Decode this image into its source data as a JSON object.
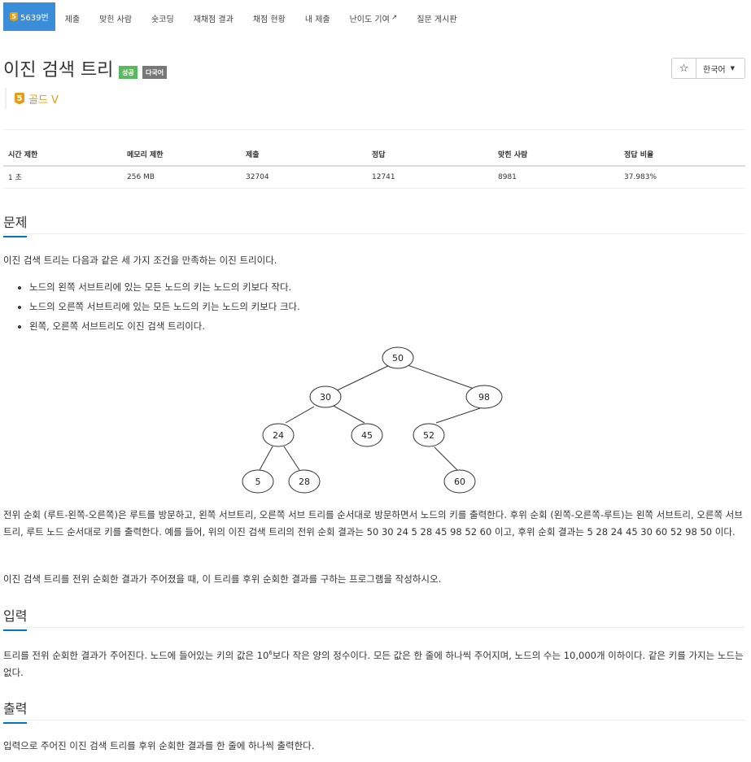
{
  "nav": {
    "problem_id": "5639번",
    "tier_digit": "5",
    "tabs": [
      "제출",
      "맞힌 사람",
      "숏코딩",
      "재채점 결과",
      "채점 현황",
      "내 제출",
      "난이도 기여",
      "질문 게시판"
    ]
  },
  "problem": {
    "title": "이진 검색 트리",
    "labels": {
      "success": "성공",
      "multilang": "다국어"
    },
    "tier": "골드 V",
    "tier_digit": "5",
    "lang": "한국어",
    "star": "☆"
  },
  "info_table": {
    "headers": [
      "시간 제한",
      "메모리 제한",
      "제출",
      "정답",
      "맞힌 사람",
      "정답 비율"
    ],
    "values": [
      "1 초",
      "256 MB",
      "32704",
      "12741",
      "8981",
      "37.983%"
    ]
  },
  "sections": {
    "problem_title": "문제",
    "problem_intro": "이진 검색 트리는 다음과 같은 세 가지 조건을 만족하는 이진 트리이다.",
    "conditions": [
      "노드의 왼쪽 서브트리에 있는 모든 노드의 키는 노드의 키보다 작다.",
      "노드의 오른쪽 서브트리에 있는 모든 노드의 키는 노드의 키보다 크다.",
      "왼쪽, 오른쪽 서브트리도 이진 검색 트리이다."
    ],
    "traversal_text": "전위 순회 (루트-왼쪽-오른쪽)은 루트를 방문하고, 왼쪽 서브트리, 오른쪽 서브 트리를 순서대로 방문하면서 노드의 키를 출력한다. 후위 순회 (왼쪽-오른쪽-루트)는 왼쪽 서브트리, 오른쪽 서브트리, 루트 노드 순서대로 키를 출력한다. 예를 들어, 위의 이진 검색 트리의 전위 순회 결과는 50 30 24 5 28 45 98 52 60 이고, 후위 순회 결과는 5 28 24 45 30 60 52 98 50 이다.",
    "task_text": "이진 검색 트리를 전위 순회한 결과가 주어졌을 때, 이 트리를 후위 순회한 결과를 구하는 프로그램을 작성하시오.",
    "input_title": "입력",
    "input_text_a": "트리를 전위 순회한 결과가 주어진다. 노드에 들어있는 키의 값은 10",
    "input_sup": "6",
    "input_text_b": "보다 작은 양의 정수이다. 모든 값은 한 줄에 하나씩 주어지며, 노드의 수는 10,000개 이하이다. 같은 키를 가지는 노드는 없다.",
    "output_title": "출력",
    "output_text": "입력으로 주어진 이진 검색 트리를 후위 순회한 결과를 한 줄에 하나씩 출력한다."
  },
  "tree_nodes": [
    "50",
    "30",
    "98",
    "24",
    "45",
    "52",
    "5",
    "28",
    "60"
  ]
}
